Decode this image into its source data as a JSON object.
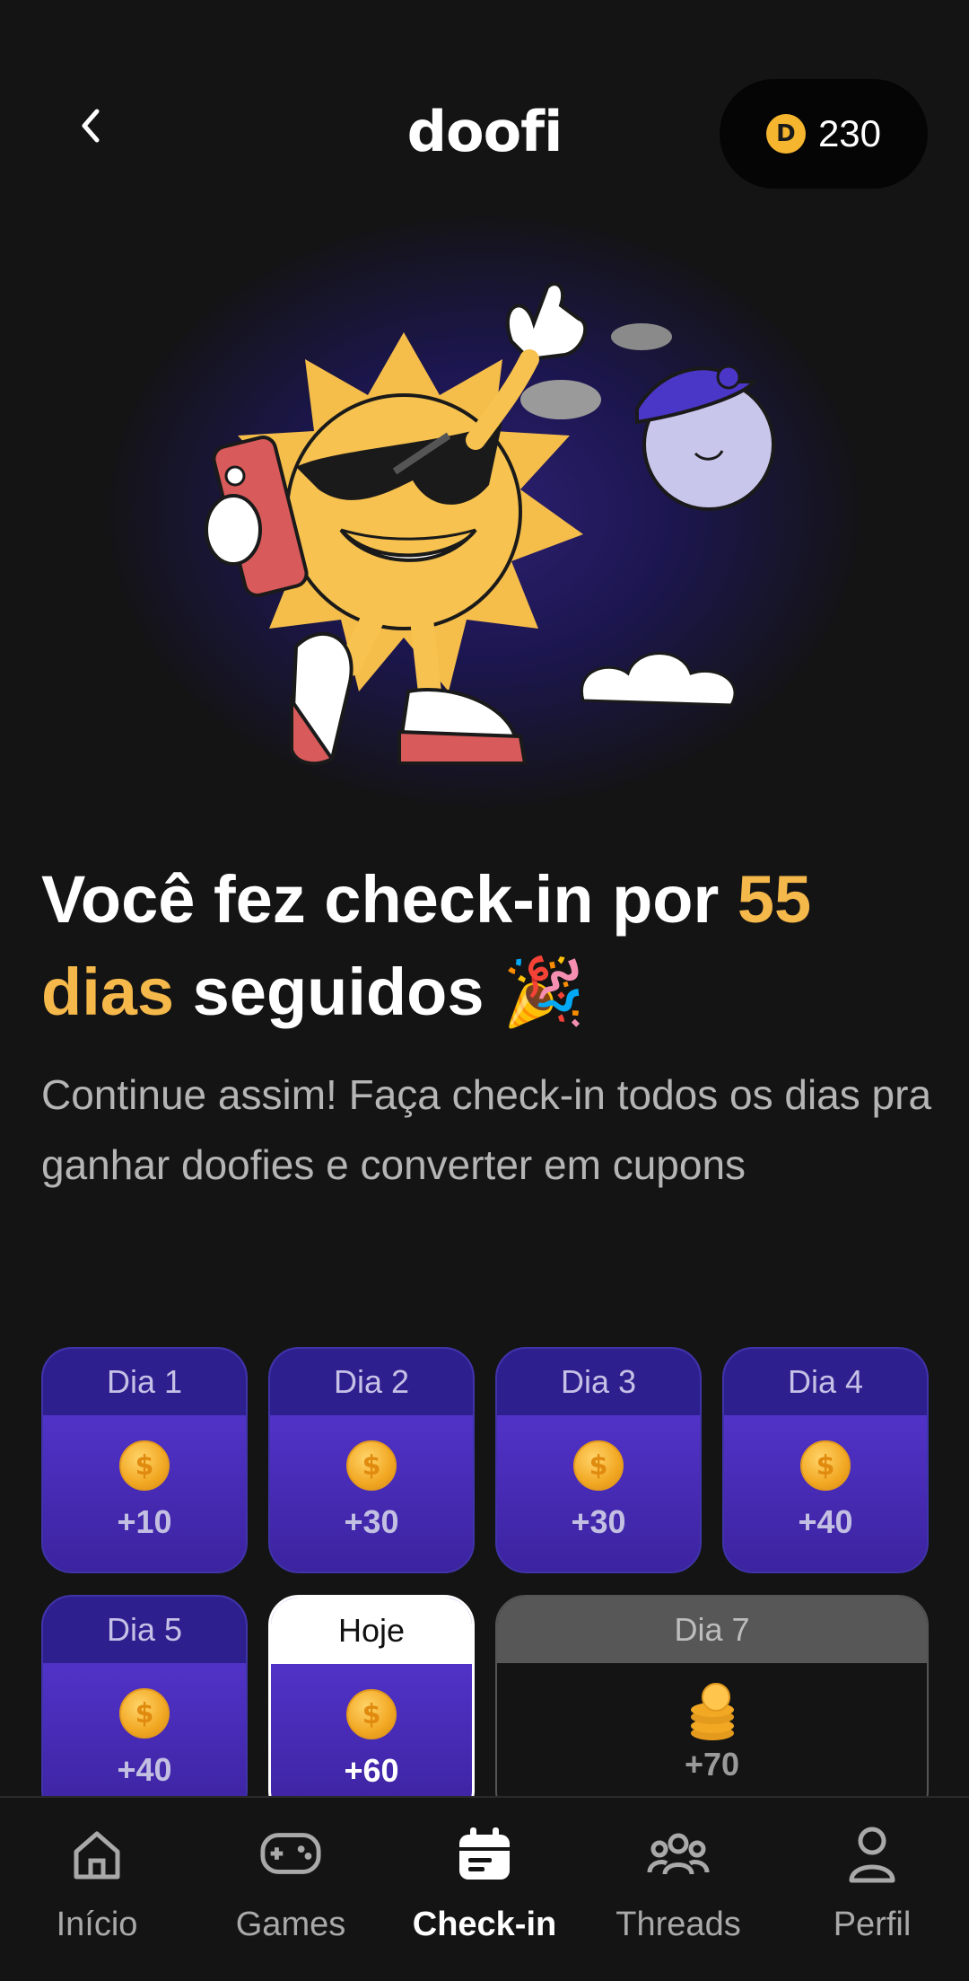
{
  "header": {
    "back_icon": "chevron-left-icon",
    "logo": "doofi",
    "balance": "230",
    "coin_symbol": "D"
  },
  "headline": {
    "part1": "Você fez check-in por ",
    "highlight1": "55",
    "highlight2": "dias",
    "part2": " seguidos",
    "emoji": "🎉"
  },
  "subtext": "Continue assim! Faça check-in todos os dias pra ganhar doofies e converter em cupons",
  "days": [
    {
      "label": "Dia 1",
      "amount": "+10"
    },
    {
      "label": "Dia 2",
      "amount": "+30"
    },
    {
      "label": "Dia 3",
      "amount": "+30"
    },
    {
      "label": "Dia 4",
      "amount": "+40"
    },
    {
      "label": "Dia 5",
      "amount": "+40"
    },
    {
      "label": "Hoje",
      "amount": "+60"
    },
    {
      "label": "Dia 7",
      "amount": "+70"
    }
  ],
  "nav": [
    {
      "label": "Início",
      "icon": "home-icon"
    },
    {
      "label": "Games",
      "icon": "gamepad-icon"
    },
    {
      "label": "Check-in",
      "icon": "calendar-icon",
      "active": true
    },
    {
      "label": "Threads",
      "icon": "group-icon"
    },
    {
      "label": "Perfil",
      "icon": "user-icon"
    }
  ],
  "colors": {
    "background": "#141414",
    "accent_yellow": "#f5b84a",
    "card_purple": "#5a39d9",
    "card_label_purple": "#2e1f8e",
    "coin": "#f5b52e"
  }
}
